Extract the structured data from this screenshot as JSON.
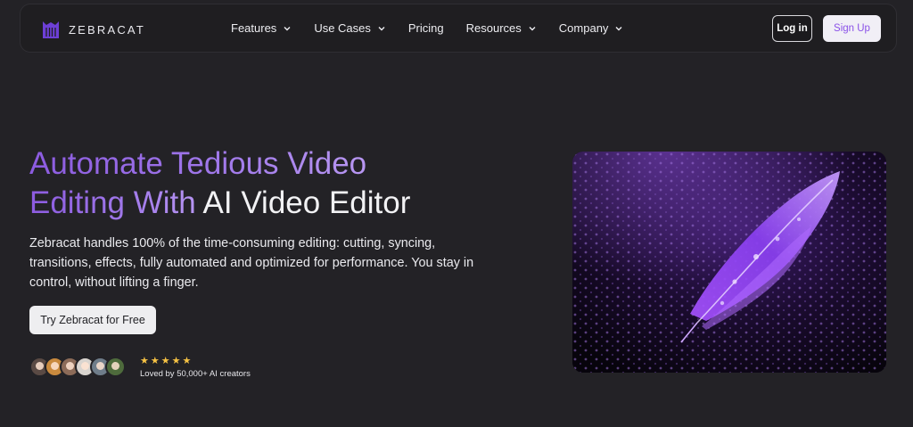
{
  "brand": {
    "name": "ZEBRACAT",
    "logo_icon": "zebracat-logo-icon",
    "accent": "#8b52e8"
  },
  "nav": {
    "items": [
      {
        "label": "Features",
        "has_dropdown": true
      },
      {
        "label": "Use Cases",
        "has_dropdown": true
      },
      {
        "label": "Pricing",
        "has_dropdown": false
      },
      {
        "label": "Resources",
        "has_dropdown": true
      },
      {
        "label": "Company",
        "has_dropdown": true
      }
    ],
    "login_label": "Log in",
    "signup_label": "Sign Up"
  },
  "hero": {
    "title_line1": "Automate Tedious Video",
    "title_line2_accent": "Editing With ",
    "title_line2_plain": "AI Video Editor",
    "description": "Zebracat handles 100% of the time-consuming editing: cutting, syncing, transitions, effects, fully automated and optimized for performance. You stay in control, without lifting a finger.",
    "cta_label": "Try Zebracat for Free",
    "rating_stars": "★★★★★",
    "social_proof": "Loved by 50,000+ AI creators",
    "avatar_count": 6,
    "image_subject": "purple-feather-with-water-droplets"
  }
}
